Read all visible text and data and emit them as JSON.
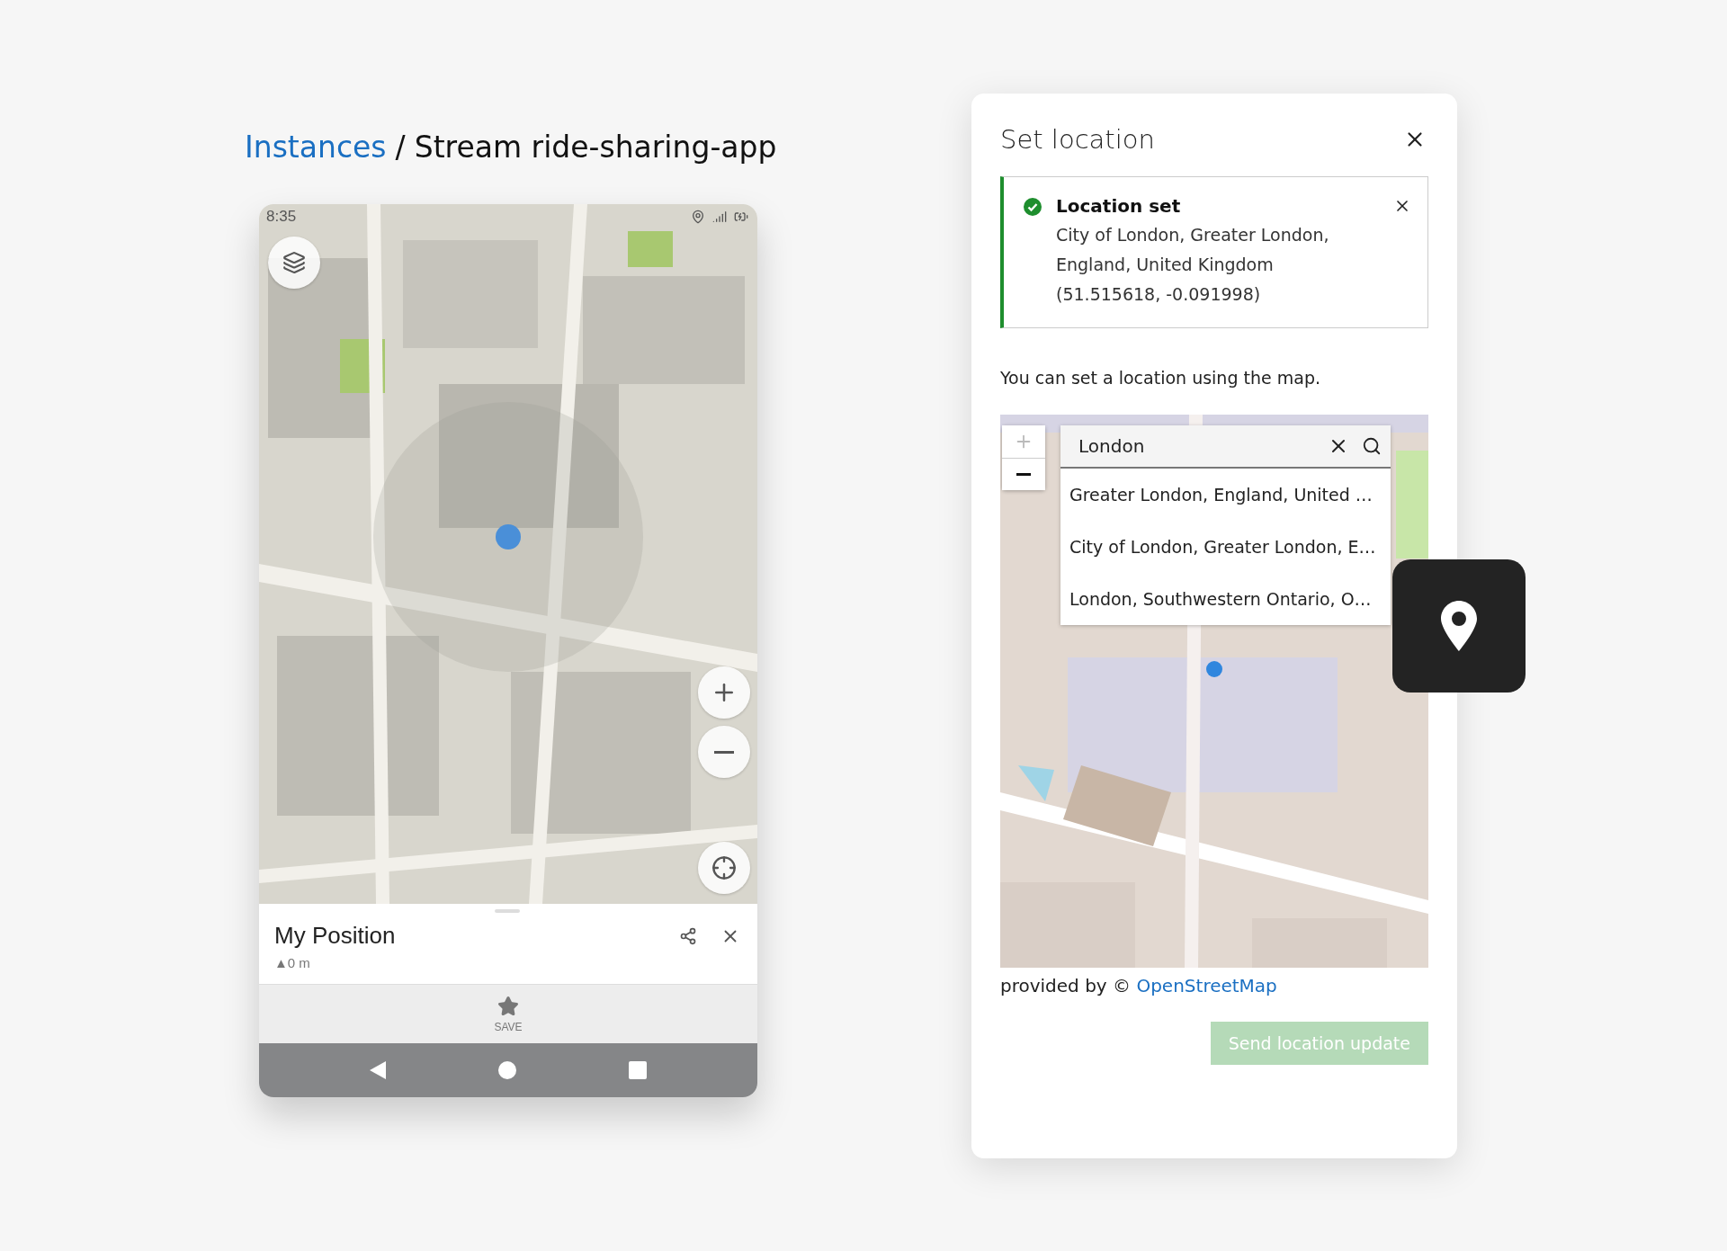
{
  "breadcrumb": {
    "link": "Instances",
    "separator": "/",
    "current": "Stream ride-sharing-app"
  },
  "phone": {
    "status_time": "8:35",
    "sheet": {
      "title": "My Position",
      "elevation": "▲0 m"
    },
    "actions": [
      {
        "label": "SAVE"
      }
    ]
  },
  "dialog": {
    "title": "Set location",
    "alert": {
      "kind": "success",
      "title": "Location set",
      "message": "City of London, Greater London, England, United Kingdom (51.515618, -0.091998)"
    },
    "hint": "You can set a location using the map.",
    "map": {
      "search": {
        "value": "London"
      },
      "results": [
        {
          "label": "Greater London, England, United …"
        },
        {
          "label": "City of London, Greater London, E…"
        },
        {
          "label": "London, Southwestern Ontario, O…"
        }
      ]
    },
    "attribution": {
      "text": "provided by ©",
      "link": "OpenStreetMap"
    },
    "submit": {
      "label": "Send location update",
      "disabled": true
    }
  }
}
